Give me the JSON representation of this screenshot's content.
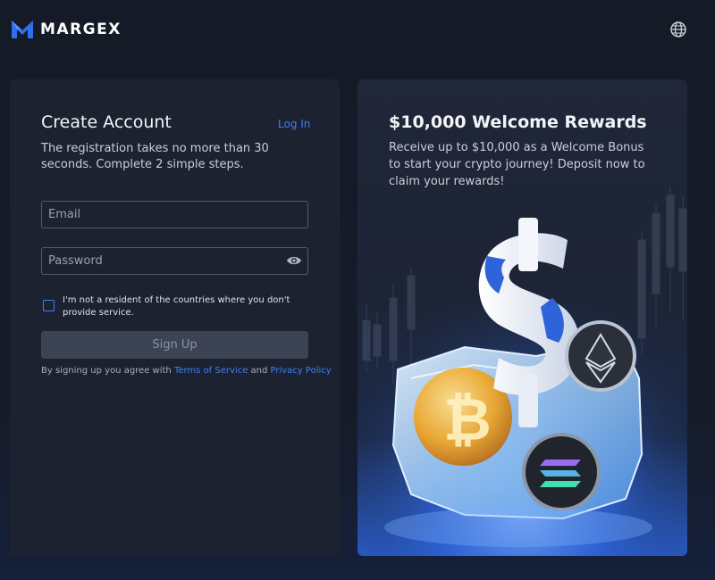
{
  "header": {
    "brand_name": "MARGEX",
    "language_icon": "globe-icon"
  },
  "register": {
    "title": "Create Account",
    "login_link": "Log In",
    "description": "The registration takes no more than 30 seconds. Complete 2 simple steps.",
    "email_placeholder": "Email",
    "password_placeholder": "Password",
    "password_toggle_icon": "eye-icon",
    "residency_checkbox_checked": false,
    "residency_label": "I'm not a resident of the countries where you don't provide service.",
    "signup_button": "Sign Up",
    "terms_prefix": "By signing up you agree with ",
    "terms_link": "Terms of Service",
    "terms_and": " and ",
    "privacy_link": "Privacy Policy"
  },
  "promo": {
    "title": "$10,000 Welcome Rewards",
    "description": "Receive up to $10,000 as a Welcome Bonus to start your crypto journey! Deposit now to claim your rewards!",
    "illustration_icons": [
      "dollar-sign-icon",
      "bitcoin-coin-icon",
      "ethereum-coin-icon",
      "solana-coin-icon",
      "ice-block"
    ]
  },
  "colors": {
    "background": "#141925",
    "card": "#1c2230",
    "accent": "#3b82f6",
    "signup_disabled": "#3c4352"
  }
}
